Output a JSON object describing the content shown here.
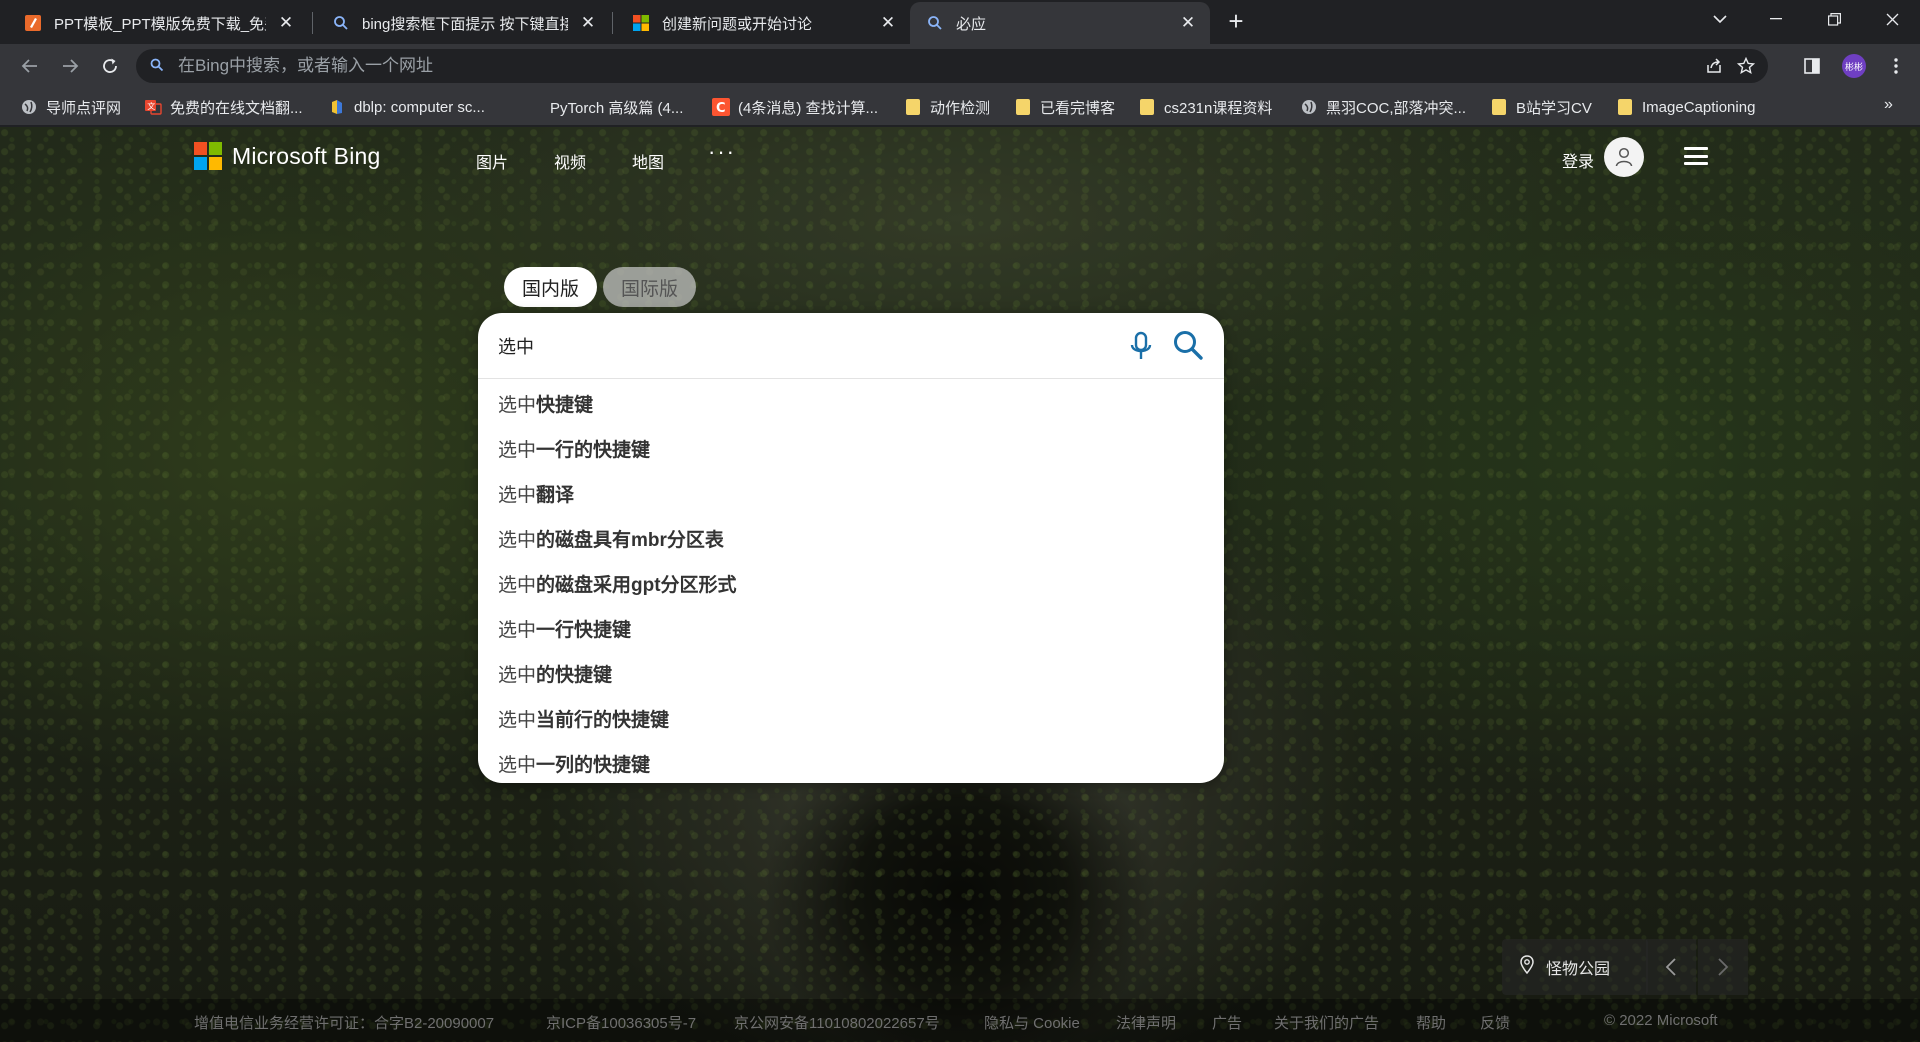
{
  "browser": {
    "tabs": [
      {
        "title": "PPT模板_PPT模版免费下载_免费",
        "icon": "ppt-favicon",
        "active": false
      },
      {
        "title": "bing搜索框下面提示 按下键直接",
        "icon": "search-favicon",
        "active": false
      },
      {
        "title": "创建新问题或开始讨论",
        "icon": "microsoft-favicon",
        "active": false
      },
      {
        "title": "必应",
        "icon": "search-favicon",
        "active": true
      }
    ],
    "address_placeholder": "在Bing中搜索，或者输入一个网址",
    "profile_initials": "彬彬",
    "bookmarks": [
      {
        "label": "导师点评网",
        "icon": "globe-icon"
      },
      {
        "label": "免费的在线文档翻...",
        "icon": "translate-icon"
      },
      {
        "label": "dblp: computer sc...",
        "icon": "dblp-icon"
      },
      {
        "label": "PyTorch 高级篇 (4...",
        "icon": "blank-icon"
      },
      {
        "label": "(4条消息) 查找计算...",
        "icon": "csdn-icon"
      },
      {
        "label": "动作检测",
        "icon": "folder-icon"
      },
      {
        "label": "已看完博客",
        "icon": "folder-icon"
      },
      {
        "label": "cs231n课程资料",
        "icon": "folder-icon"
      },
      {
        "label": "黑羽COC,部落冲突...",
        "icon": "globe-icon"
      },
      {
        "label": "B站学习CV",
        "icon": "folder-icon"
      },
      {
        "label": "ImageCaptioning",
        "icon": "folder-icon"
      }
    ],
    "bookmarks_more": "»"
  },
  "bing": {
    "logo_text": "Microsoft Bing",
    "nav": [
      "图片",
      "视频",
      "地图"
    ],
    "more": "···",
    "login": "登录",
    "region_tabs": [
      "国内版",
      "国际版"
    ],
    "query": "选中",
    "suggestions": [
      {
        "prefix": "选中",
        "rest": "快捷键"
      },
      {
        "prefix": "选中",
        "rest": "一行的快捷键"
      },
      {
        "prefix": "选中",
        "rest": "翻译"
      },
      {
        "prefix": "选中",
        "rest": "的磁盘具有mbr分区表"
      },
      {
        "prefix": "选中",
        "rest": "的磁盘采用gpt分区形式"
      },
      {
        "prefix": "选中",
        "rest": "一行快捷键"
      },
      {
        "prefix": "选中",
        "rest": "的快捷键"
      },
      {
        "prefix": "选中",
        "rest": "当前行的快捷键"
      },
      {
        "prefix": "选中",
        "rest": "一列的快捷键"
      }
    ],
    "location": "怪物公园",
    "footer": [
      "增值电信业务经营许可证：合字B2-20090007",
      "京ICP备10036305号-7",
      "京公网安备11010802022657号",
      "隐私与 Cookie",
      "法律声明",
      "广告",
      "关于我们的广告",
      "帮助",
      "反馈",
      "© 2022 Microsoft"
    ]
  },
  "colors": {
    "ms_red": "#f25022",
    "ms_green": "#7fba00",
    "ms_blue": "#00a4ef",
    "ms_yellow": "#ffb900",
    "bing_accent": "#1a6fa8"
  }
}
